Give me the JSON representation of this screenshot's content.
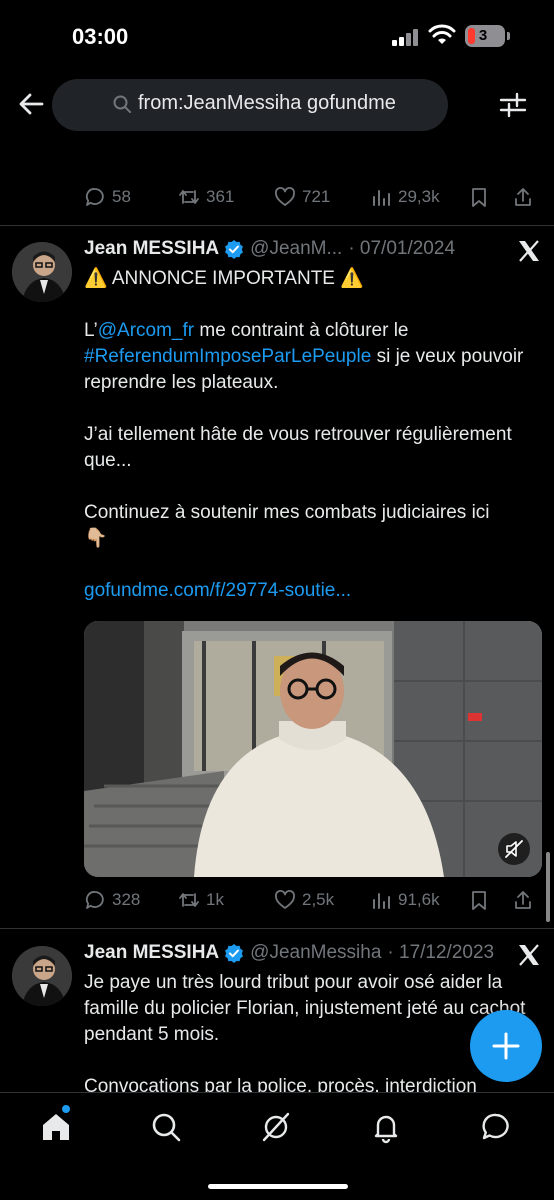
{
  "status_bar": {
    "time": "03:00",
    "battery": "3"
  },
  "search": {
    "query": "from:JeanMessiha gofundme"
  },
  "top_tweet_actions": {
    "replies": "58",
    "reposts": "361",
    "likes": "721",
    "views": "29,3k"
  },
  "tweet1": {
    "author": "Jean MESSIHA",
    "handle": "@JeanM...",
    "date": "· 07/01/2024",
    "line1": "⚠️ ANNONCE IMPORTANTE ⚠️",
    "p1_prefix": "L’",
    "p1_mention": "@Arcom_fr",
    "p1_rest": " me contraint à clôturer le",
    "p1_hashtag": "#ReferendumImposeParLePeuple",
    "p1_tail": " si je veux pouvoir reprendre les plateaux.",
    "p2": "J’ai tellement hâte de vous retrouver régulièrement que...",
    "p3": "Continuez à soutenir mes combats judiciaires ici",
    "p3_emoji": "👇🏼",
    "link": "gofundme.com/f/29774-soutie...",
    "actions": {
      "replies": "328",
      "reposts": "1k",
      "likes": "2,5k",
      "views": "91,6k"
    }
  },
  "tweet2": {
    "author": "Jean MESSIHA",
    "handle": "@JeanMessiha",
    "date": "· 17/12/2023",
    "p1": "Je paye un très lourd tribut pour avoir osé aider la famille du policier Florian, injustement jeté au cachot pendant 5 mois.",
    "p2": "Convocations par la police, procès, interdiction"
  },
  "colors": {
    "accent": "#1d9bf0",
    "muted": "#71767b",
    "background": "#000000"
  }
}
